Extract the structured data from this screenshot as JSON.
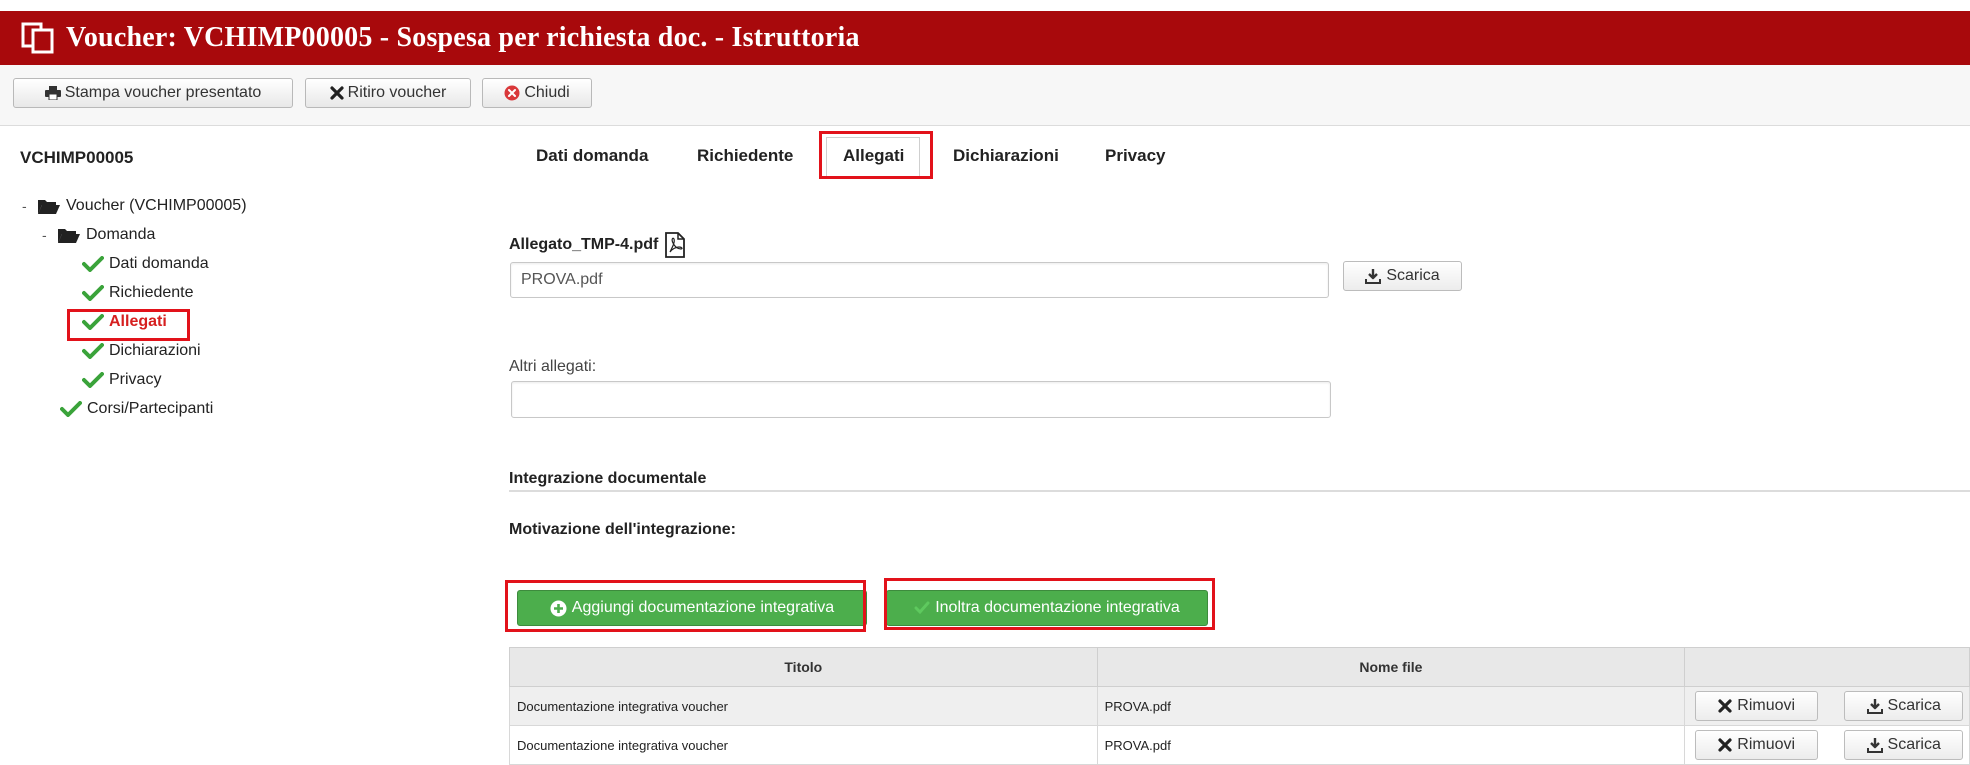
{
  "header": {
    "title": "Voucher: VCHIMP00005 - Sospesa per richiesta doc. - Istruttoria"
  },
  "toolbar": {
    "print_label": "Stampa voucher presentato",
    "withdraw_label": "Ritiro voucher",
    "close_label": "Chiudi"
  },
  "sidebar": {
    "code": "VCHIMP00005",
    "tree": {
      "root": {
        "toggle": "-",
        "label": "Voucher (VCHIMP00005)"
      },
      "domanda": {
        "toggle": "-",
        "label": "Domanda"
      },
      "children": [
        {
          "label": "Dati domanda"
        },
        {
          "label": "Richiedente"
        },
        {
          "label": "Allegati",
          "selected": true
        },
        {
          "label": "Dichiarazioni"
        },
        {
          "label": "Privacy"
        }
      ],
      "courses": {
        "label": "Corsi/Partecipanti"
      }
    }
  },
  "tabs": [
    {
      "label": "Dati domanda"
    },
    {
      "label": "Richiedente"
    },
    {
      "label": "Allegati",
      "active": true
    },
    {
      "label": "Dichiarazioni"
    },
    {
      "label": "Privacy"
    }
  ],
  "attachment": {
    "label": "Allegato_TMP-4.pdf",
    "value": "PROVA.pdf",
    "download_label": "Scarica"
  },
  "other_attachments": {
    "label": "Altri allegati:",
    "value": ""
  },
  "integration": {
    "section_title": "Integrazione documentale",
    "reason_label": "Motivazione dell'integrazione:",
    "add_label": "Aggiungi documentazione integrativa",
    "send_label": "Inoltra documentazione integrativa"
  },
  "table": {
    "headers": [
      "Titolo",
      "Nome file",
      ""
    ],
    "rows": [
      {
        "title": "Documentazione integrativa voucher",
        "file": "PROVA.pdf",
        "remove": "Rimuovi",
        "download": "Scarica"
      },
      {
        "title": "Documentazione integrativa voucher",
        "file": "PROVA.pdf",
        "remove": "Rimuovi",
        "download": "Scarica"
      }
    ]
  },
  "colors": {
    "header_bg": "#a8090c",
    "highlight": "#e2121a",
    "success": "#4cae4c",
    "check": "#3aa33a"
  }
}
